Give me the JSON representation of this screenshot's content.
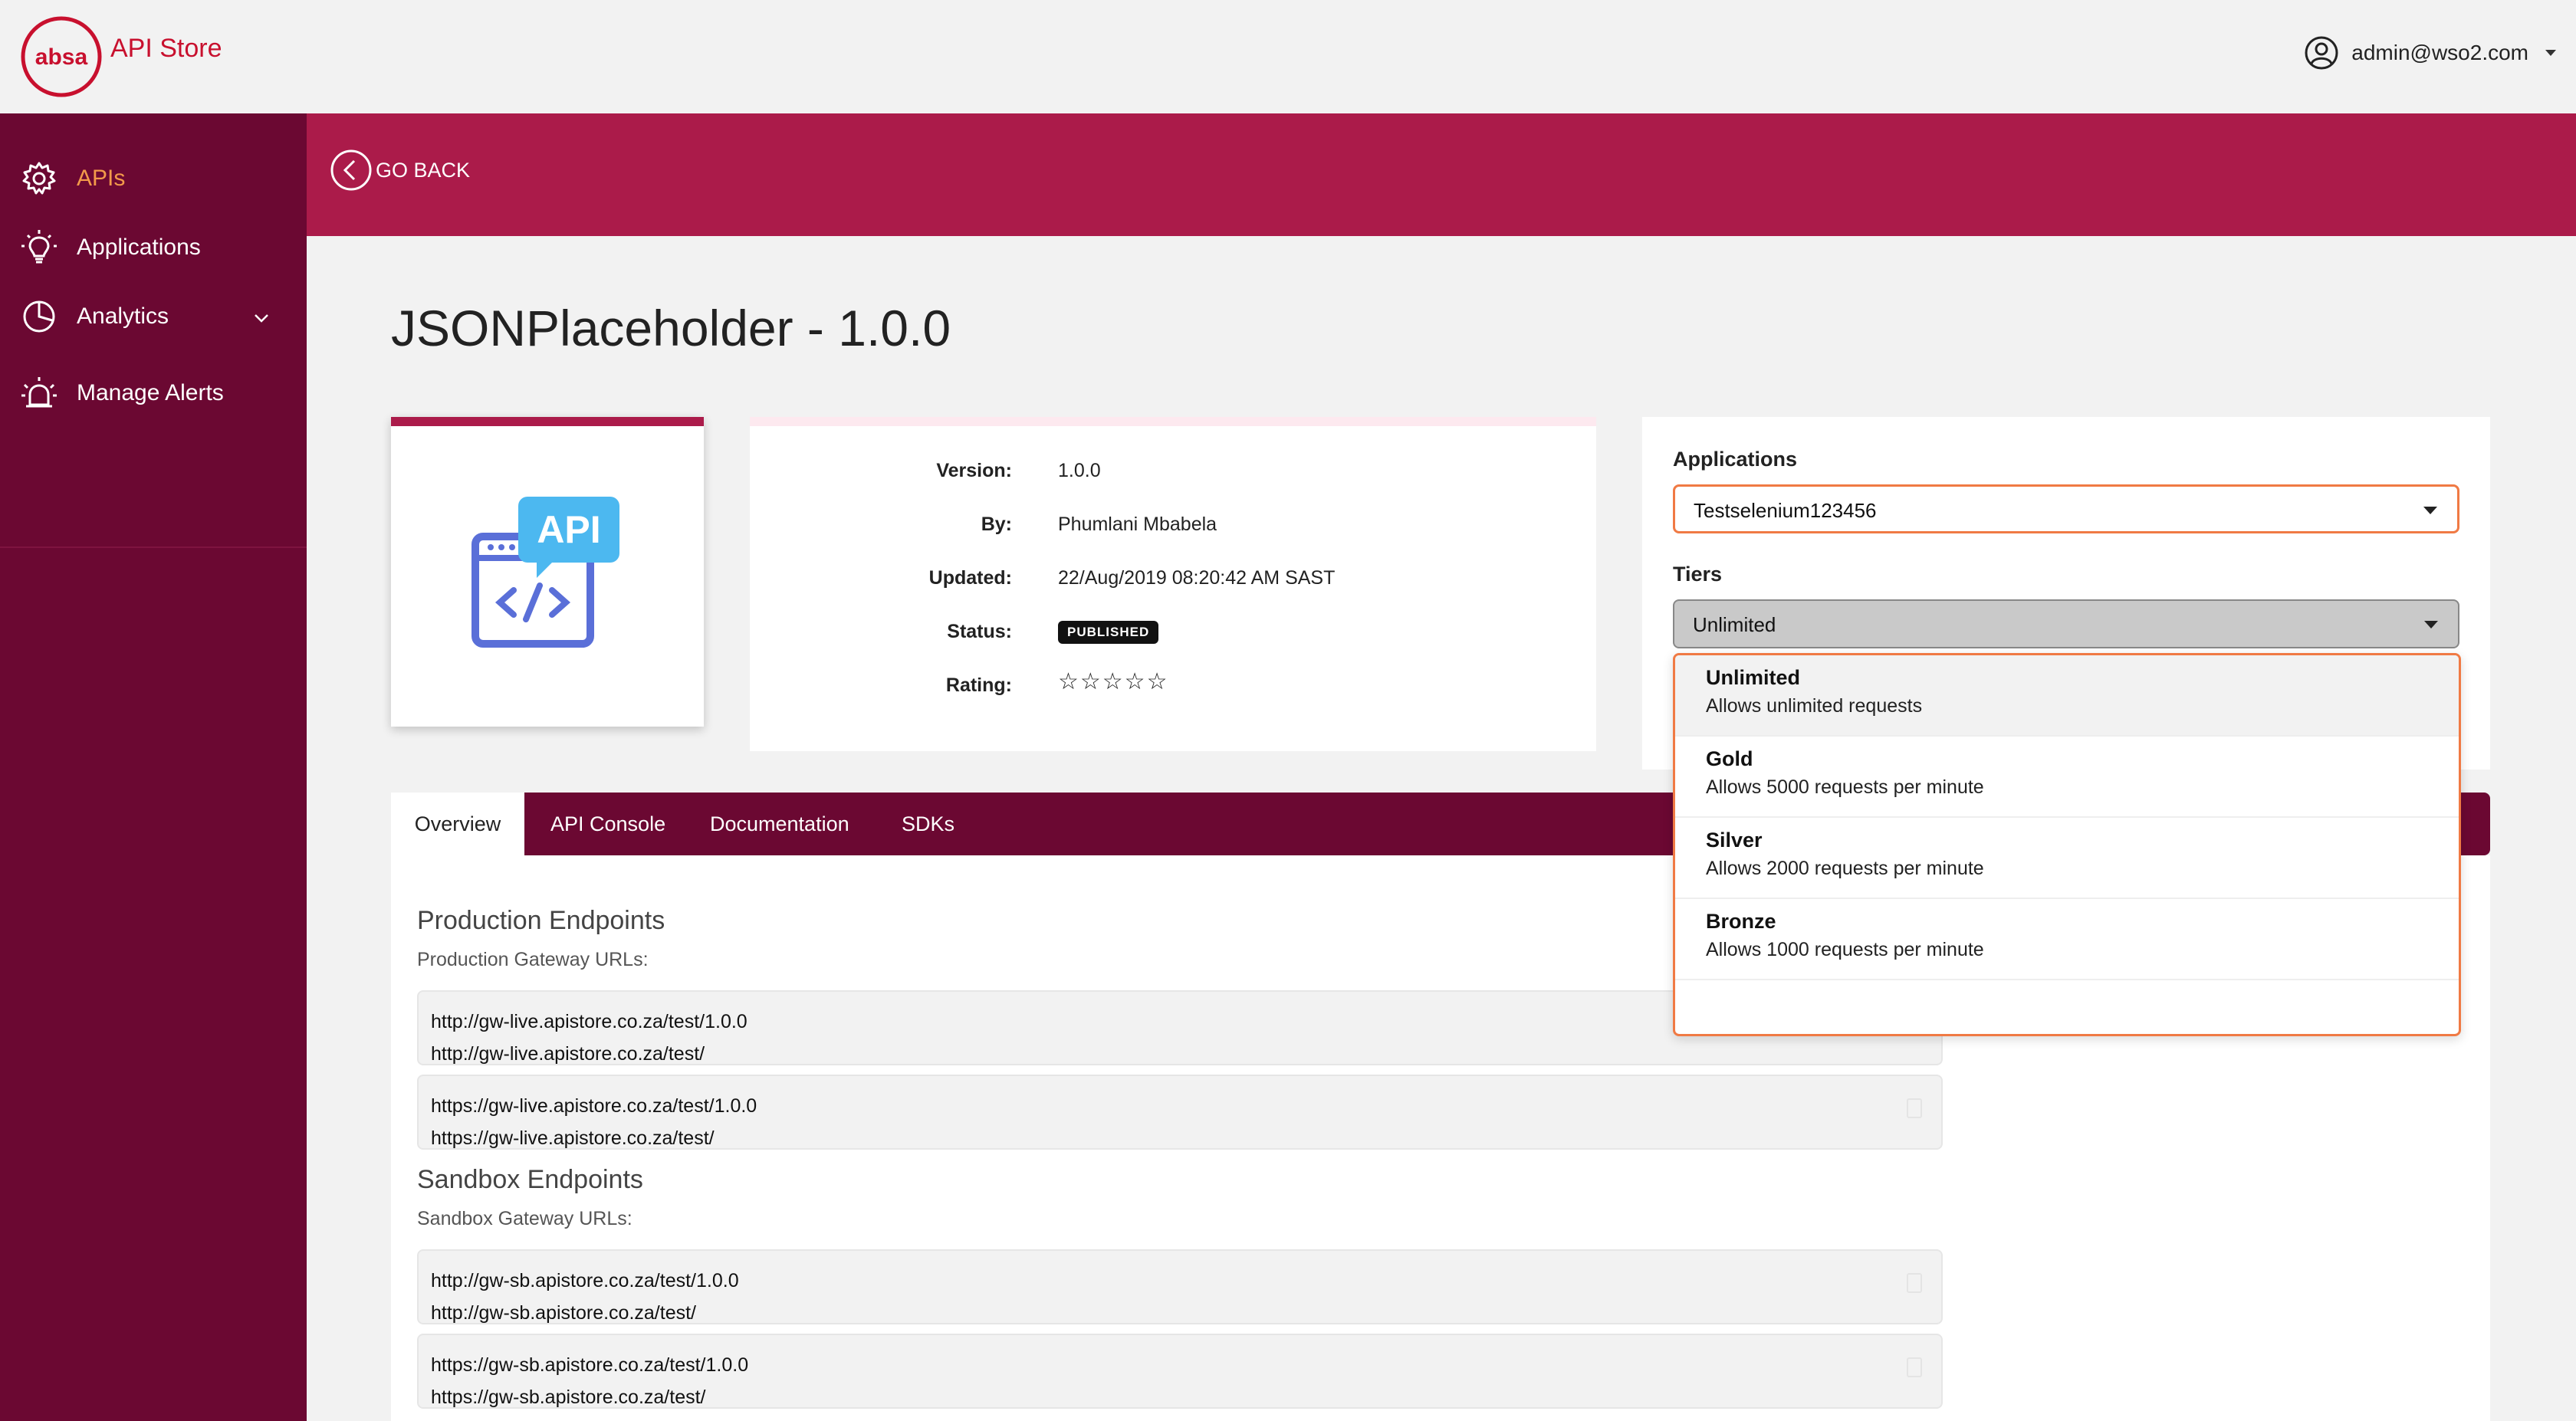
{
  "header": {
    "logo_text": "absa",
    "store_title": "API Store",
    "user": "admin@wso2.com"
  },
  "sidebar": {
    "items": [
      {
        "label": "APIs",
        "icon": "gear-icon",
        "active": true
      },
      {
        "label": "Applications",
        "icon": "lightbulb-icon",
        "active": false
      },
      {
        "label": "Analytics",
        "icon": "pie-chart-icon",
        "active": false
      },
      {
        "label": "Manage Alerts",
        "icon": "alarm-icon",
        "active": false
      }
    ]
  },
  "banner": {
    "go_back": "GO BACK"
  },
  "api": {
    "title": "JSONPlaceholder - 1.0.0",
    "thumbnail_text": "API",
    "info": [
      {
        "label": "Version:",
        "value": "1.0.0"
      },
      {
        "label": "By:",
        "value": "Phumlani Mbabela"
      },
      {
        "label": "Updated:",
        "value": "22/Aug/2019 08:20:42 AM SAST"
      },
      {
        "label": "Status:",
        "value": "PUBLISHED"
      },
      {
        "label": "Rating:",
        "value": "☆☆☆☆☆"
      }
    ]
  },
  "subscribe": {
    "applications_label": "Applications",
    "application_selected": "Testselenium123456",
    "tiers_label": "Tiers",
    "tier_selected": "Unlimited",
    "tier_options": [
      {
        "name": "Unlimited",
        "desc": "Allows unlimited requests"
      },
      {
        "name": "Gold",
        "desc": "Allows 5000 requests per minute"
      },
      {
        "name": "Silver",
        "desc": "Allows 2000 requests per minute"
      },
      {
        "name": "Bronze",
        "desc": "Allows 1000 requests per minute"
      }
    ]
  },
  "tabs": [
    "Overview",
    "API Console",
    "Documentation",
    "SDKs"
  ],
  "endpoints": {
    "production_title": "Production Endpoints",
    "production_sub": "Production Gateway URLs:",
    "production_urls": [
      [
        "http://gw-live.apistore.co.za/test/1.0.0",
        "http://gw-live.apistore.co.za/test/"
      ],
      [
        "https://gw-live.apistore.co.za/test/1.0.0",
        "https://gw-live.apistore.co.za/test/"
      ]
    ],
    "sandbox_title": "Sandbox Endpoints",
    "sandbox_sub": "Sandbox Gateway URLs:",
    "sandbox_urls": [
      [
        "http://gw-sb.apistore.co.za/test/1.0.0",
        "http://gw-sb.apistore.co.za/test/"
      ],
      [
        "https://gw-sb.apistore.co.za/test/1.0.0",
        "https://gw-sb.apistore.co.za/test/"
      ]
    ]
  },
  "colors": {
    "brand": "#c8102e",
    "sidebar": "#6b0832",
    "banner": "#ab1b4a",
    "active_nav": "#f39a4a",
    "focus_border": "#f07a44"
  }
}
